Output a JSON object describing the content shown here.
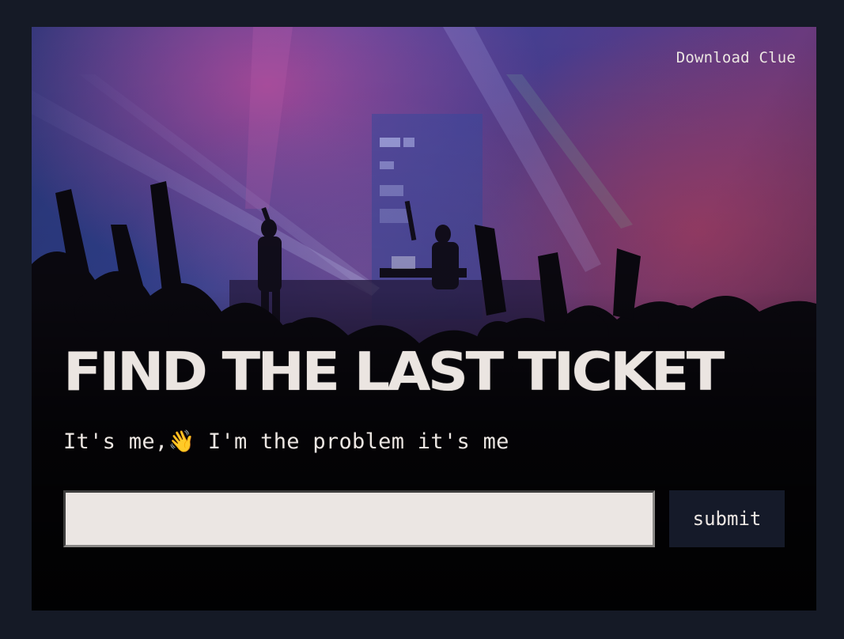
{
  "nav": {
    "download_label": "Download Clue"
  },
  "hero": {
    "title": "FIND THE LAST TICKET",
    "tagline": "It's me,👋 I'm the problem it's me"
  },
  "form": {
    "input_value": "",
    "input_placeholder": "",
    "submit_label": "submit"
  },
  "colors": {
    "page_background": "#151a26",
    "text_light": "#ece6e2",
    "input_background": "#ebe6e3",
    "button_background": "#151a29",
    "stage_blue": "#3a4fa0",
    "stage_purple": "#7a3a86",
    "crowd_dark": "#0e0c12"
  },
  "icons": {
    "background_image": "concert-stage-photo"
  }
}
